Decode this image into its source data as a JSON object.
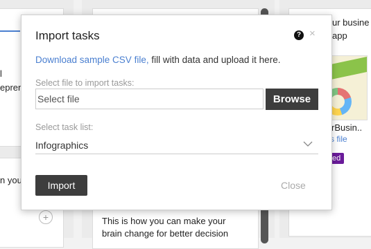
{
  "background": {
    "col1_text_1": "l",
    "col1_text_2": "epren",
    "col1_text_3": "n you",
    "col2_card_text_1": "This is how you can make your",
    "col2_card_text_2": "brain change for better decision",
    "col3_text_1": "ur busine",
    "col3_text_2": "app",
    "col3_text_3": "rBusin..",
    "col3_link": "s file",
    "col3_badge": "ed",
    "add_symbol": "+"
  },
  "modal": {
    "title": "Import tasks",
    "help_symbol": "?",
    "close_symbol": "×",
    "desc_link": "Download sample CSV file,",
    "desc_rest": " fill with data and upload it here.",
    "file_label": "Select file to import tasks:",
    "file_placeholder": "Select file",
    "browse_label": "Browse",
    "list_label": "Select task list:",
    "list_value": "Infographics",
    "import_label": "Import",
    "close_label": "Close"
  },
  "colors": {
    "accent_link": "#4a7fd0",
    "button_dark": "#3d3d3d",
    "badge_purple": "#6a1b9a"
  }
}
